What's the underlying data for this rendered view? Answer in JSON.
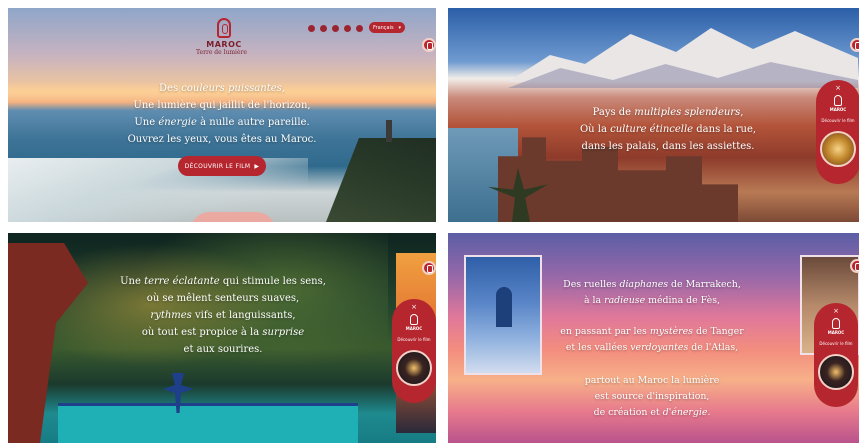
{
  "panel1": {
    "logo": {
      "name": "MAROC",
      "tagline": "Terre de lumière"
    },
    "socials": [
      "instagram-icon",
      "pinterest-icon",
      "facebook-icon",
      "youtube-icon",
      "twitter-icon"
    ],
    "language": {
      "selected": "Français",
      "caret": "▾"
    },
    "verse": [
      [
        "Des ",
        "couleurs puissantes",
        ","
      ],
      [
        "Une lumière qui jaillit de l'horizon,"
      ],
      [
        "Une ",
        "énergie",
        " à nulle autre pareille."
      ],
      [
        "Ouvrez les yeux, vous êtes au Maroc."
      ]
    ],
    "film_button": {
      "label": "DÉCOUVRIR LE FILM",
      "arrow": "▶"
    }
  },
  "panel2": {
    "verse": [
      [
        "Pays de ",
        "multiples splendeurs",
        ","
      ],
      [
        "Où la ",
        "culture étincelle",
        " dans la rue,"
      ],
      [
        "dans les palais, dans les assiettes."
      ]
    ],
    "side_card": {
      "close": "×",
      "name": "MAROC",
      "label": "Découvrir le film"
    }
  },
  "panel3": {
    "verse": [
      [
        "Une ",
        "terre éclatante",
        " qui stimule les sens,"
      ],
      [
        "où se mêlent senteurs suaves,"
      ],
      [
        "",
        "rythmes",
        " vifs et languissants,"
      ],
      [
        "où tout est propice à la ",
        "surprise",
        ""
      ],
      [
        "et aux sourires."
      ]
    ],
    "side_card": {
      "close": "×",
      "name": "MAROC",
      "label": "Découvrir le film"
    }
  },
  "panel4": {
    "verse_top": [
      [
        "Des ruelles ",
        "diaphanes",
        " de Marrakech,"
      ],
      [
        "à la ",
        "radieuse",
        " médina de Fès,"
      ]
    ],
    "verse_mid": [
      [
        "en passant par les ",
        "mystères",
        " de Tanger"
      ],
      [
        "et les vallées ",
        "verdoyantes",
        " de l'Atlas,"
      ]
    ],
    "verse_bottom": [
      [
        "partout au Maroc la lumière"
      ],
      [
        "est source d'inspiration,"
      ],
      [
        "de création et ",
        "d'énergie",
        "."
      ]
    ],
    "side_card": {
      "close": "×",
      "name": "MAROC",
      "label": "Découvrir le film"
    }
  }
}
